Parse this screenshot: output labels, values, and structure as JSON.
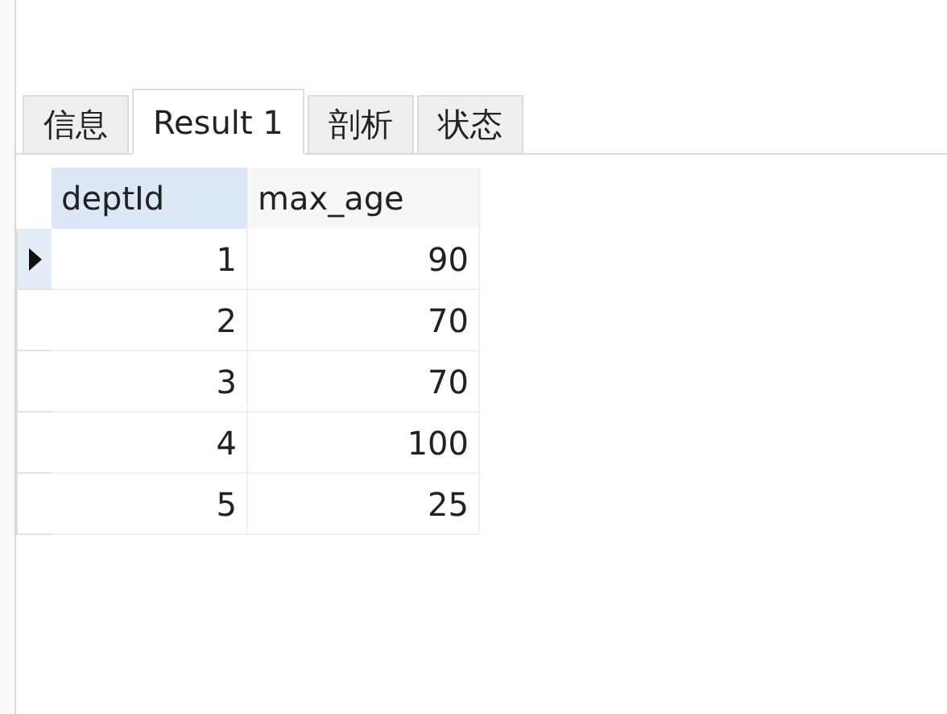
{
  "tabs": [
    {
      "label": "信息",
      "selected": false
    },
    {
      "label": "Result 1",
      "selected": true
    },
    {
      "label": "剖析",
      "selected": false
    },
    {
      "label": "状态",
      "selected": false
    }
  ],
  "table": {
    "columns": [
      {
        "label": "deptId",
        "selected": true
      },
      {
        "label": "max_age",
        "selected": false
      }
    ],
    "rows": [
      {
        "cells": [
          "1",
          "90"
        ],
        "selected": true
      },
      {
        "cells": [
          "2",
          "70"
        ],
        "selected": false
      },
      {
        "cells": [
          "3",
          "70"
        ],
        "selected": false
      },
      {
        "cells": [
          "4",
          "100"
        ],
        "selected": false
      },
      {
        "cells": [
          "5",
          "25"
        ],
        "selected": false
      }
    ]
  }
}
